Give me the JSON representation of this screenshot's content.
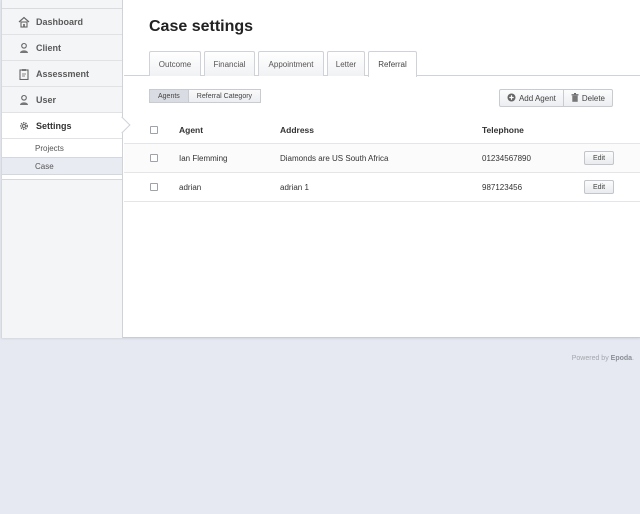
{
  "sidebar": {
    "items": [
      {
        "label": "Dashboard",
        "icon": "home-icon"
      },
      {
        "label": "Client",
        "icon": "person-icon"
      },
      {
        "label": "Assessment",
        "icon": "clipboard-icon"
      },
      {
        "label": "User",
        "icon": "person-icon"
      },
      {
        "label": "Settings",
        "icon": "gear-icon"
      }
    ],
    "subitems": [
      {
        "label": "Projects"
      },
      {
        "label": "Case"
      }
    ]
  },
  "main": {
    "title": "Case settings",
    "tabs": [
      "Outcome",
      "Financial",
      "Appointment",
      "Letter",
      "Referral"
    ],
    "active_tab": "Referral",
    "subtabs": [
      "Agents",
      "Referral Category"
    ],
    "active_subtab": "Agents",
    "actions": {
      "add_label": "Add Agent",
      "delete_label": "Delete"
    }
  },
  "table": {
    "columns": [
      "Agent",
      "Address",
      "Telephone"
    ],
    "rows": [
      {
        "agent": "Ian Flemming",
        "address": "Diamonds are US South Africa",
        "telephone": "01234567890",
        "action": "Edit"
      },
      {
        "agent": "adrian",
        "address": "adrian 1",
        "telephone": "987123456",
        "action": "Edit"
      }
    ]
  },
  "footer": {
    "prefix": "Powered by",
    "brand": "Epoda",
    "suffix": "."
  }
}
